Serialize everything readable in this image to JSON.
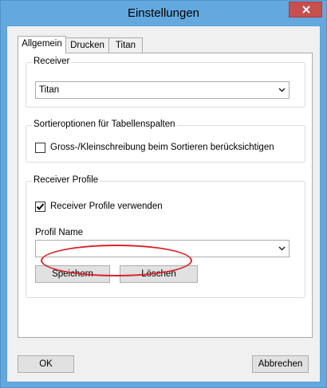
{
  "window": {
    "title": "Einstellungen",
    "close_glyph": "close-icon"
  },
  "tabs": [
    {
      "label": "Allgemein",
      "active": true
    },
    {
      "label": "Drucken",
      "active": false
    },
    {
      "label": "Titan",
      "active": false
    }
  ],
  "receiver_group": {
    "label": "Receiver",
    "selected": "Titan"
  },
  "sort_group": {
    "label": "Sortieroptionen für Tabellenspalten",
    "case_checkbox": {
      "label": "Gross-/Kleinschreibung beim Sortieren berücksichtigen",
      "checked": false
    }
  },
  "profile_group": {
    "label": "Receiver Profile",
    "use_checkbox": {
      "label": "Receiver Profile verwenden",
      "checked": true
    },
    "profile_name_label": "Profil Name",
    "profile_name_value": "",
    "save_label": "Speichern",
    "delete_label": "Löschen"
  },
  "footer": {
    "ok_label": "OK",
    "cancel_label": "Abbrechen"
  },
  "colors": {
    "title_bar": "#63a9df",
    "close_button": "#c7504f",
    "highlight_ellipse": "#d8232a"
  }
}
